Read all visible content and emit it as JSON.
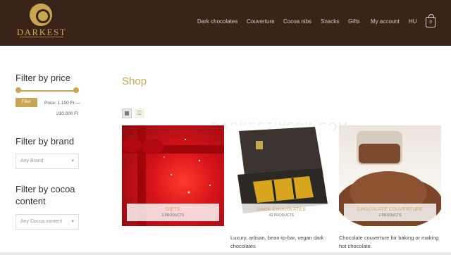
{
  "header": {
    "logo_text": "DARKEST",
    "nav": [
      "Dark chocolates",
      "Couverture",
      "Cocoa nibs",
      "Snacks",
      "Gifts",
      "My account",
      "HU"
    ],
    "cart_count": "3"
  },
  "sidebar": {
    "price_title": "Filter by price",
    "filter_button": "Filter",
    "price_label": "Price: 1.100 Ft —",
    "price_max": "210.000 Ft",
    "brand_title": "Filter by brand",
    "brand_select": "Any Brand",
    "cocoa_title": "Filter by cocoa content",
    "cocoa_select": "Any Cocoa content"
  },
  "main": {
    "title": "Shop",
    "watermark": "DARKESTWERK.COM",
    "categories": [
      {
        "name": "GIFTS",
        "count": "3 PRODUCTS",
        "desc": ""
      },
      {
        "name": "DARK CHOCOLATES",
        "count": "42 PRODUCTS",
        "desc": "Luxury, artisan, bean-to-bar, vegan dark chocolates"
      },
      {
        "name": "CHOCOLATE COUVERTURE",
        "count": "2 PRODUCTS",
        "desc": "Chocolate couverture for baking or making hot chocolate."
      }
    ]
  },
  "colors": {
    "brown": "#3a2419",
    "gold": "#c9a752"
  }
}
